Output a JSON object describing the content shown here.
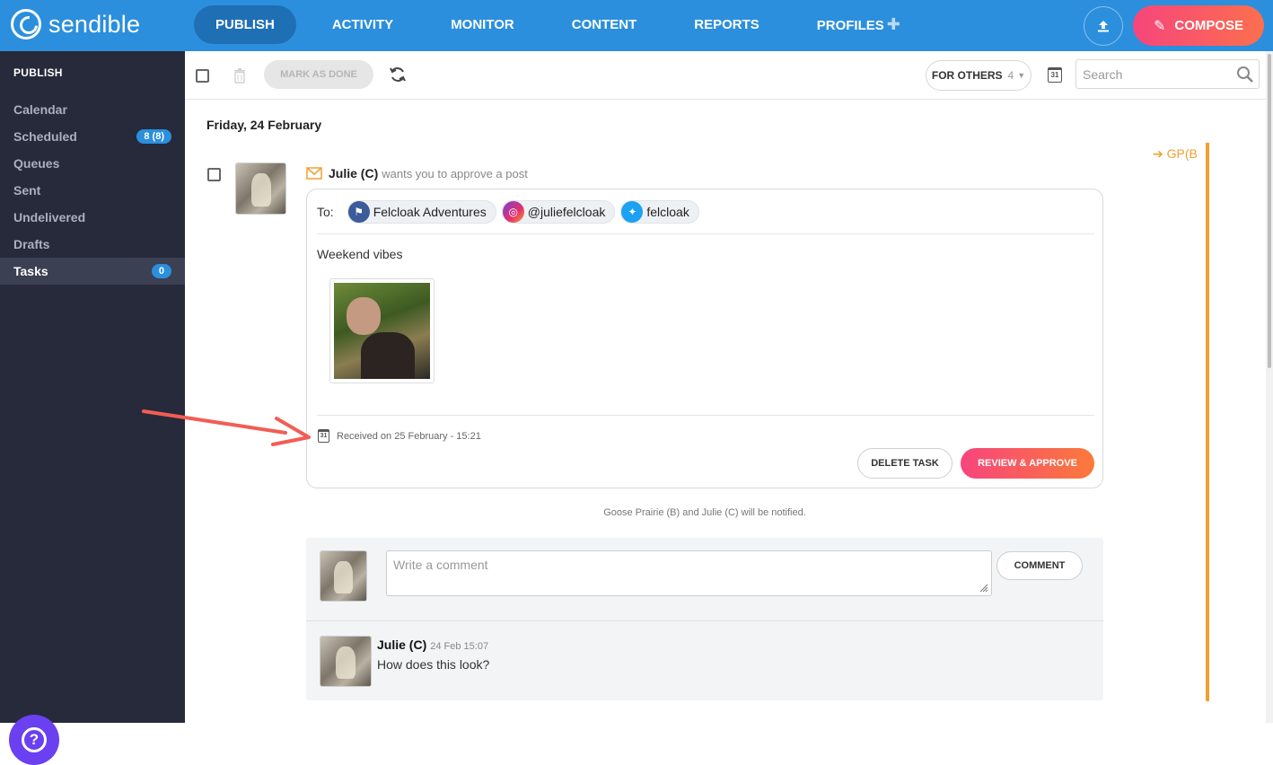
{
  "app": {
    "logo_text": "sendible",
    "nav": [
      {
        "label": "PUBLISH",
        "active": true
      },
      {
        "label": "ACTIVITY",
        "active": false
      },
      {
        "label": "MONITOR",
        "active": false
      },
      {
        "label": "CONTENT",
        "active": false
      },
      {
        "label": "REPORTS",
        "active": false
      },
      {
        "label": "PROFILES",
        "active": false
      }
    ],
    "compose_label": "COMPOSE",
    "accent_color": "#2b8fdd",
    "compose_gradient": [
      "#f7457c",
      "#fb6f4e"
    ]
  },
  "sidebar": {
    "title": "PUBLISH",
    "items": [
      {
        "label": "Calendar"
      },
      {
        "label": "Scheduled",
        "badge": "8 (8)"
      },
      {
        "label": "Queues"
      },
      {
        "label": "Sent"
      },
      {
        "label": "Undelivered"
      },
      {
        "label": "Drafts"
      },
      {
        "label": "Tasks",
        "badge": "0",
        "active": true
      }
    ],
    "help_label": "?"
  },
  "toolbar": {
    "mark_done_label": "MARK AS DONE",
    "filter_label": "FOR OTHERS",
    "filter_count": "4",
    "calendar_day": "31",
    "search_placeholder": "Search"
  },
  "task": {
    "date_heading": "Friday, 24 February",
    "author": "Julie (C)",
    "action_text": "wants you to approve a post",
    "assignee_tag": "GP(B",
    "to_label": "To:",
    "recipients": [
      {
        "name": "Felcloak Adventures",
        "icon": "facebook-page-icon"
      },
      {
        "name": "@juliefelcloak",
        "icon": "instagram-icon"
      },
      {
        "name": "felcloak",
        "icon": "twitter-icon"
      }
    ],
    "post_text": "Weekend vibes",
    "received_text": "Received on 25 February - 15:21",
    "received_cal_day": "31",
    "delete_label": "DELETE TASK",
    "approve_label": "REVIEW & APPROVE",
    "notify_text": "Goose Prairie (B) and Julie (C) will be notified.",
    "status_color": "#f0a030"
  },
  "comments": {
    "placeholder": "Write a comment",
    "button_label": "COMMENT",
    "items": [
      {
        "author": "Julie (C)",
        "time": "24 Feb 15:07",
        "text": "How does this look?"
      }
    ]
  }
}
